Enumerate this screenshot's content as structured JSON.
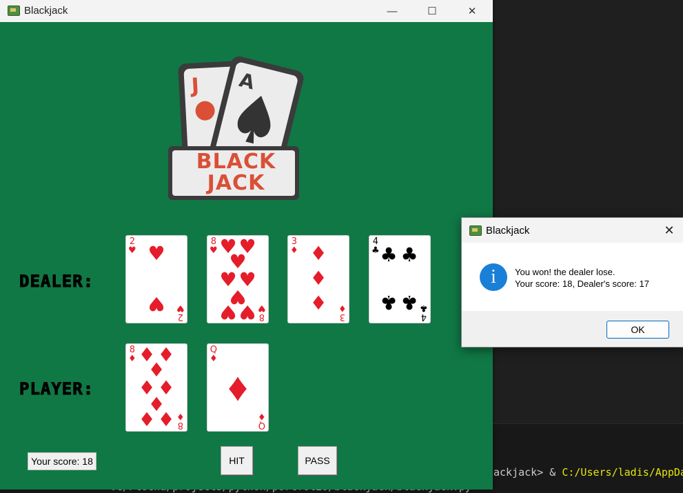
{
  "window": {
    "title": "Blackjack",
    "controls": {
      "minimize": "—",
      "maximize": "☐",
      "close": "✕"
    }
  },
  "logo": {
    "line1": "BLACK",
    "line2": "JACK"
  },
  "table": {
    "dealer_label": "DEALER:",
    "player_label": "PLAYER:",
    "dealer_cards": [
      {
        "rank": "2",
        "suit": "♥",
        "color": "red"
      },
      {
        "rank": "8",
        "suit": "♥",
        "color": "red"
      },
      {
        "rank": "3",
        "suit": "♦",
        "color": "red"
      },
      {
        "rank": "4",
        "suit": "♣",
        "color": "black"
      }
    ],
    "player_cards": [
      {
        "rank": "8",
        "suit": "♦",
        "color": "red"
      },
      {
        "rank": "Q",
        "suit": "♦",
        "color": "red"
      }
    ]
  },
  "controls": {
    "score_label": "Your score: 18",
    "hit_label": "HIT",
    "pass_label": "PASS"
  },
  "dialog": {
    "title": "Blackjack",
    "close": "✕",
    "icon": "info-icon",
    "message_line1": "You won! the dealer lose.",
    "message_line2": "Your score: 18, Dealer's score: 17",
    "ok_label": "OK"
  },
  "terminal": {
    "prompt_fragment": "ackjack> & ",
    "path_fragment": "C:/Users/ladis/AppDa",
    "line2": "ve/Plocha/projects/python/portfolio/blackjack/blackjack.py"
  },
  "colors": {
    "felt": "#107845",
    "card_red": "#e51d2a",
    "info_blue": "#1a7fd6"
  }
}
